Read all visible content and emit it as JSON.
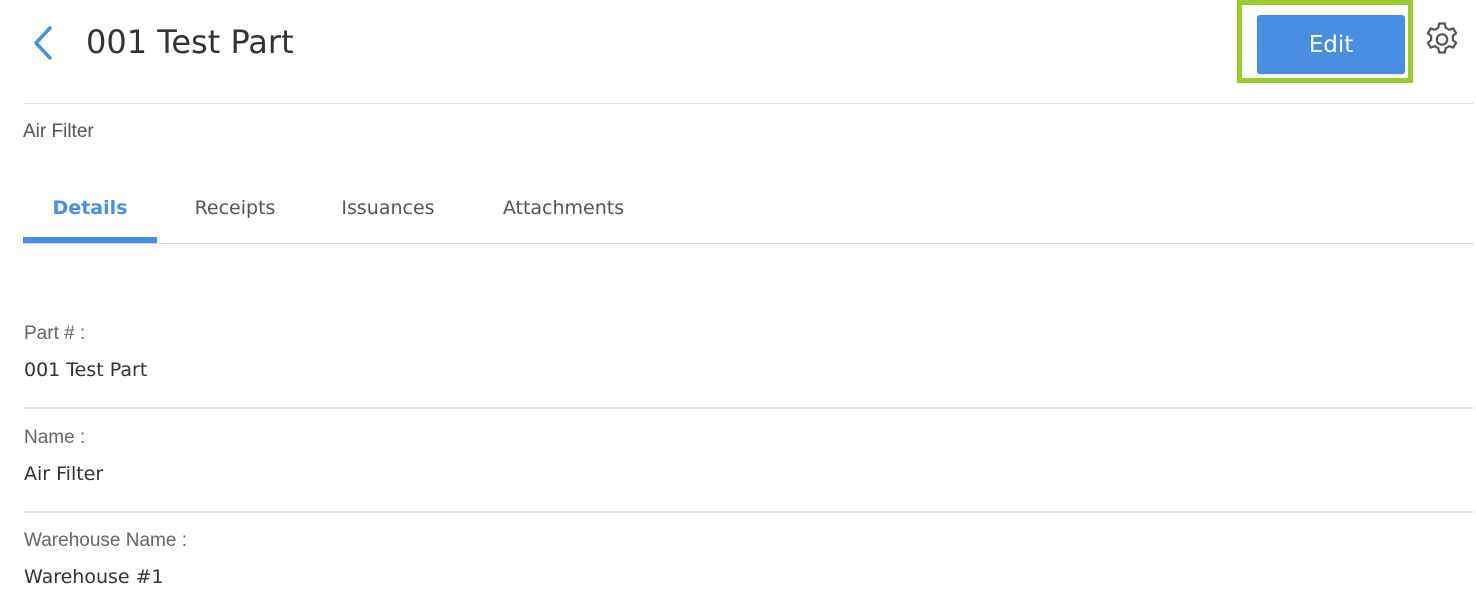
{
  "header": {
    "title": "001 Test Part",
    "edit_label": "Edit",
    "back_icon": "chevron-left-icon",
    "settings_icon": "gear-icon"
  },
  "subtitle": "Air Filter",
  "tabs": [
    {
      "label": "Details",
      "active": true
    },
    {
      "label": "Receipts",
      "active": false
    },
    {
      "label": "Issuances",
      "active": false
    },
    {
      "label": "Attachments",
      "active": false
    }
  ],
  "details": [
    {
      "label": "Part # :",
      "value": "001 Test Part"
    },
    {
      "label": "Name :",
      "value": "Air Filter"
    },
    {
      "label": "Warehouse Name :",
      "value": "Warehouse #1"
    }
  ],
  "colors": {
    "accent": "#4a8ee4",
    "highlight": "#9ccc2c"
  }
}
